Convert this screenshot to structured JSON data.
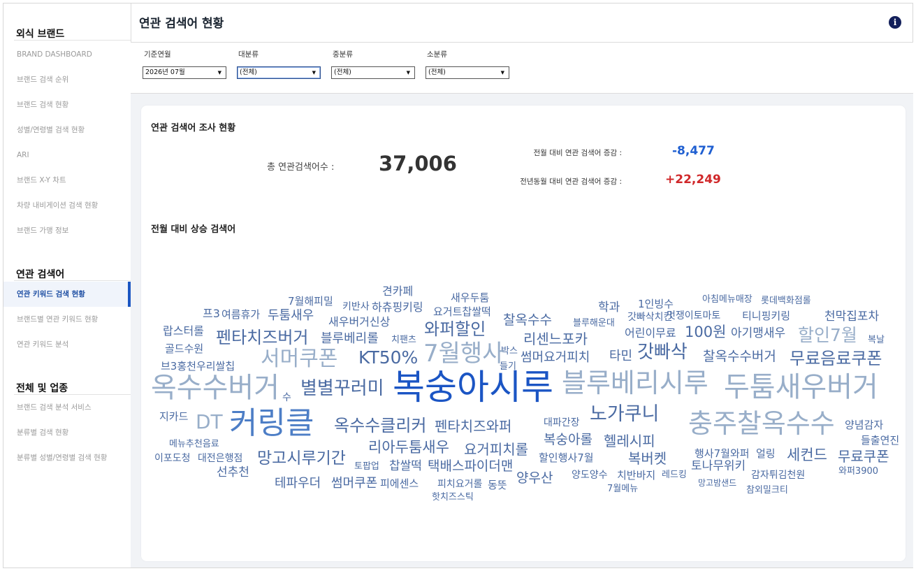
{
  "sidebar": {
    "section1": {
      "title": "외식 브랜드",
      "items": [
        {
          "label": "BRAND DASHBOARD"
        },
        {
          "label": "브랜드 검색 순위"
        },
        {
          "label": "브랜드 검색 현황"
        },
        {
          "label": "성별/연령별 검색 현황"
        },
        {
          "label": "ARI"
        },
        {
          "label": "브랜드 X-Y 차트"
        },
        {
          "label": "차량 내비게이션 검색 현황"
        },
        {
          "label": "브랜드 가맹 정보"
        }
      ]
    },
    "section2": {
      "title": "연관 검색어",
      "items": [
        {
          "label": "연관 키워드 검색 현황",
          "active": true
        },
        {
          "label": "브랜드별 연관 키워드 현황"
        },
        {
          "label": "연관 키워드 분석"
        }
      ]
    },
    "section3": {
      "title": "전체 및 업종",
      "items": [
        {
          "label": "브랜드 검색 분석 서비스"
        },
        {
          "label": "분류별 검색 현황"
        },
        {
          "label": "분류별 성별/연령별 검색 현황"
        }
      ]
    }
  },
  "header": {
    "title": "연관 검색어 현황",
    "info_icon": "info-icon"
  },
  "filters": [
    {
      "label": "기준연월",
      "value": "2026년 07월"
    },
    {
      "label": "대분류",
      "value": "(전체)"
    },
    {
      "label": "중분류",
      "value": "(전체)"
    },
    {
      "label": "소분류",
      "value": "(전체)"
    }
  ],
  "summary": {
    "title": "연관 검색어 조사 현황",
    "total_label": "총 연관검색어수 :",
    "total_value": "37,006",
    "mom_label": "전월 대비 연관 검색어 증감 :",
    "mom_value": "-8,477",
    "yoy_label": "전년동월 대비 연관 검색어 증감 :",
    "yoy_value": "+22,249"
  },
  "cloud_title": "전월 대비 상승 검색어",
  "colors": {
    "accent": "#1b56c2",
    "negative": "#1f5fd1",
    "positive": "#d0282a",
    "cloud_dark": "#4a6aa2",
    "cloud_light": "#98aec9",
    "cloud_strong": "#1b55c4"
  },
  "word_cloud": [
    {
      "text": "견카페",
      "size": 16,
      "color": "d"
    },
    {
      "text": "새우두툼",
      "size": 15,
      "color": "d"
    },
    {
      "text": "7월해피밀",
      "size": 15,
      "color": "d"
    },
    {
      "text": "키반사",
      "size": 14,
      "color": "d"
    },
    {
      "text": "하츄핑키링",
      "size": 16,
      "color": "d"
    },
    {
      "text": "요거트찹쌀떡",
      "size": 15,
      "color": "d"
    },
    {
      "text": "학과",
      "size": 17,
      "color": "d"
    },
    {
      "text": "1인빙수",
      "size": 15,
      "color": "d"
    },
    {
      "text": "아침메뉴매장",
      "size": 13,
      "color": "d"
    },
    {
      "text": "롯데백화점롤",
      "size": 13,
      "color": "d"
    },
    {
      "text": "프3",
      "size": 16,
      "color": "d"
    },
    {
      "text": "여름휴가",
      "size": 15,
      "color": "d"
    },
    {
      "text": "두툼새우",
      "size": 18,
      "color": "d"
    },
    {
      "text": "새우버거신상",
      "size": 16,
      "color": "d"
    },
    {
      "text": "찰옥수수",
      "size": 19,
      "color": "d"
    },
    {
      "text": "블루해운대",
      "size": 13,
      "color": "d"
    },
    {
      "text": "갓빠삭치킨",
      "size": 14,
      "color": "d"
    },
    {
      "text": "멋쟁이토마토",
      "size": 14,
      "color": "d"
    },
    {
      "text": "티니핑키링",
      "size": 15,
      "color": "d"
    },
    {
      "text": "천막집포차",
      "size": 17,
      "color": "d"
    },
    {
      "text": "와퍼할인",
      "size": 24,
      "color": "d"
    },
    {
      "text": "랍스터롤",
      "size": 16,
      "color": "d"
    },
    {
      "text": "펜타치즈버거",
      "size": 24,
      "color": "d"
    },
    {
      "text": "블루베리롤",
      "size": 18,
      "color": "d"
    },
    {
      "text": "치팬츠",
      "size": 13,
      "color": "d"
    },
    {
      "text": "리센느포카",
      "size": 20,
      "color": "d"
    },
    {
      "text": "어린이무료",
      "size": 16,
      "color": "d"
    },
    {
      "text": "100원",
      "size": 21,
      "color": "d"
    },
    {
      "text": "아기맹새우",
      "size": 17,
      "color": "d"
    },
    {
      "text": "할인7월",
      "size": 25,
      "color": "l"
    },
    {
      "text": "복날",
      "size": 13,
      "color": "d"
    },
    {
      "text": "골드수원",
      "size": 15,
      "color": "d"
    },
    {
      "text": "박스",
      "size": 13,
      "color": "d"
    },
    {
      "text": "서머쿠폰",
      "size": 30,
      "color": "l"
    },
    {
      "text": "KT50%",
      "size": 25,
      "color": "d"
    },
    {
      "text": "7월행사",
      "size": 34,
      "color": "l"
    },
    {
      "text": "썸머요거피치",
      "size": 18,
      "color": "d"
    },
    {
      "text": "타민",
      "size": 18,
      "color": "d"
    },
    {
      "text": "갓빠삭",
      "size": 26,
      "color": "d"
    },
    {
      "text": "찰옥수수버거",
      "size": 19,
      "color": "d"
    },
    {
      "text": "무료음료쿠폰",
      "size": 24,
      "color": "d"
    },
    {
      "text": "브3홍천우리쌀칩",
      "size": 15,
      "color": "d"
    },
    {
      "text": "들기",
      "size": 13,
      "color": "d"
    },
    {
      "text": "옥수수버거",
      "size": 40,
      "color": "l"
    },
    {
      "text": "수",
      "size": 14,
      "color": "d"
    },
    {
      "text": "별별꾸러미",
      "size": 26,
      "color": "d"
    },
    {
      "text": "복숭아시루",
      "size": 50,
      "color": "s"
    },
    {
      "text": "블루베리시루",
      "size": 38,
      "color": "l"
    },
    {
      "text": "두툼새우버거",
      "size": 40,
      "color": "l"
    },
    {
      "text": "지카드",
      "size": 15,
      "color": "d"
    },
    {
      "text": "DT",
      "size": 28,
      "color": "l"
    },
    {
      "text": "커링클",
      "size": 44,
      "color": "m"
    },
    {
      "text": "옥수수클리커",
      "size": 24,
      "color": "d"
    },
    {
      "text": "펜타치즈와퍼",
      "size": 20,
      "color": "d"
    },
    {
      "text": "대파간장",
      "size": 14,
      "color": "d"
    },
    {
      "text": "노가쿠니",
      "size": 27,
      "color": "d"
    },
    {
      "text": "충주찰옥수수",
      "size": 38,
      "color": "l"
    },
    {
      "text": "양념감자",
      "size": 15,
      "color": "d"
    },
    {
      "text": "들출연진",
      "size": 15,
      "color": "d"
    },
    {
      "text": "메뉴추천음료",
      "size": 13,
      "color": "d"
    },
    {
      "text": "리아두툼새우",
      "size": 21,
      "color": "d"
    },
    {
      "text": "요거피치롤",
      "size": 20,
      "color": "d"
    },
    {
      "text": "복숭아롤",
      "size": 19,
      "color": "d"
    },
    {
      "text": "헬레시피",
      "size": 20,
      "color": "d"
    },
    {
      "text": "행사7월와퍼",
      "size": 15,
      "color": "d"
    },
    {
      "text": "얼링",
      "size": 15,
      "color": "d"
    },
    {
      "text": "세컨드",
      "size": 21,
      "color": "d"
    },
    {
      "text": "무료쿠폰",
      "size": 20,
      "color": "d"
    },
    {
      "text": "이포도청",
      "size": 14,
      "color": "d"
    },
    {
      "text": "대전은행점",
      "size": 14,
      "color": "d"
    },
    {
      "text": "망고시루기간",
      "size": 23,
      "color": "d"
    },
    {
      "text": "토팝업",
      "size": 13,
      "color": "d"
    },
    {
      "text": "찹쌀떡",
      "size": 17,
      "color": "d"
    },
    {
      "text": "택배스파이더맨",
      "size": 19,
      "color": "d"
    },
    {
      "text": "할인행사7월",
      "size": 15,
      "color": "d"
    },
    {
      "text": "복버켓",
      "size": 20,
      "color": "d"
    },
    {
      "text": "토나무위키",
      "size": 17,
      "color": "d"
    },
    {
      "text": "선추천",
      "size": 17,
      "color": "d"
    },
    {
      "text": "양우산",
      "size": 19,
      "color": "d"
    },
    {
      "text": "양도양수",
      "size": 14,
      "color": "d"
    },
    {
      "text": "치반바지",
      "size": 15,
      "color": "d"
    },
    {
      "text": "레드킹",
      "size": 13,
      "color": "d"
    },
    {
      "text": "감자튀김천원",
      "size": 14,
      "color": "d"
    },
    {
      "text": "와퍼3900",
      "size": 13,
      "color": "d"
    },
    {
      "text": "테파우더",
      "size": 18,
      "color": "d"
    },
    {
      "text": "썸머쿠폰",
      "size": 18,
      "color": "d"
    },
    {
      "text": "피에센스",
      "size": 15,
      "color": "d"
    },
    {
      "text": "피치요거롤",
      "size": 14,
      "color": "d"
    },
    {
      "text": "동뜻",
      "size": 15,
      "color": "d"
    },
    {
      "text": "망고밤샌드",
      "size": 12,
      "color": "d"
    },
    {
      "text": "참외밀크티",
      "size": 13,
      "color": "d"
    },
    {
      "text": "7월메뉴",
      "size": 13,
      "color": "d"
    },
    {
      "text": "핫치즈스틱",
      "size": 13,
      "color": "d"
    }
  ]
}
